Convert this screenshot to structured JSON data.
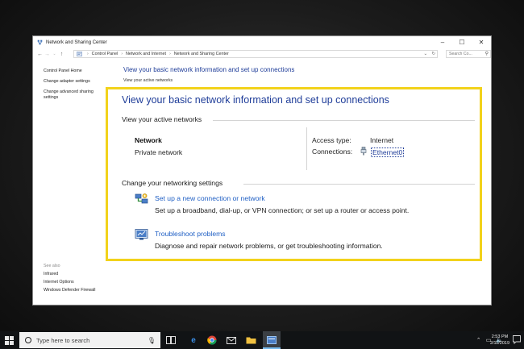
{
  "window": {
    "title": "Network and Sharing Center",
    "controls": {
      "minimize": "–",
      "maximize": "☐",
      "close": "✕"
    }
  },
  "address": {
    "back": "←",
    "forward": "→",
    "up": "↑",
    "crumbs": [
      "Control Panel",
      "Network and Internet",
      "Network and Sharing Center"
    ],
    "search_placeholder": "Search Co..."
  },
  "left_pane": {
    "links": [
      "Control Panel Home",
      "Change adapter settings",
      "Change advanced sharing settings"
    ],
    "see_also_title": "See also",
    "see_also": [
      "Infrared",
      "Internet Options",
      "Windows Defender Firewall"
    ]
  },
  "background": {
    "heading": "View your basic network information and set up connections",
    "sub": "View your active networks"
  },
  "panel": {
    "title": "View your basic network information and set up connections",
    "active_networks_title": "View your active networks",
    "network_name": "Network",
    "network_type": "Private network",
    "access_type_label": "Access type:",
    "access_type_value": "Internet",
    "connections_label": "Connections:",
    "connection_name": "Ethernet0",
    "change_settings_title": "Change your networking settings",
    "tasks": [
      {
        "link": "Set up a new connection or network",
        "desc": "Set up a broadband, dial-up, or VPN connection; or set up a router or access point.",
        "icon": "network-setup-icon"
      },
      {
        "link": "Troubleshoot problems",
        "desc": "Diagnose and repair network problems, or get troubleshooting information.",
        "icon": "troubleshoot-icon"
      }
    ]
  },
  "taskbar": {
    "search_placeholder": "Type here to search",
    "time": "2:53 PM",
    "date": "2/11/2019"
  },
  "colors": {
    "highlight": "#f2d21b",
    "link": "#1f3d99",
    "task_link": "#1f5fc4"
  }
}
